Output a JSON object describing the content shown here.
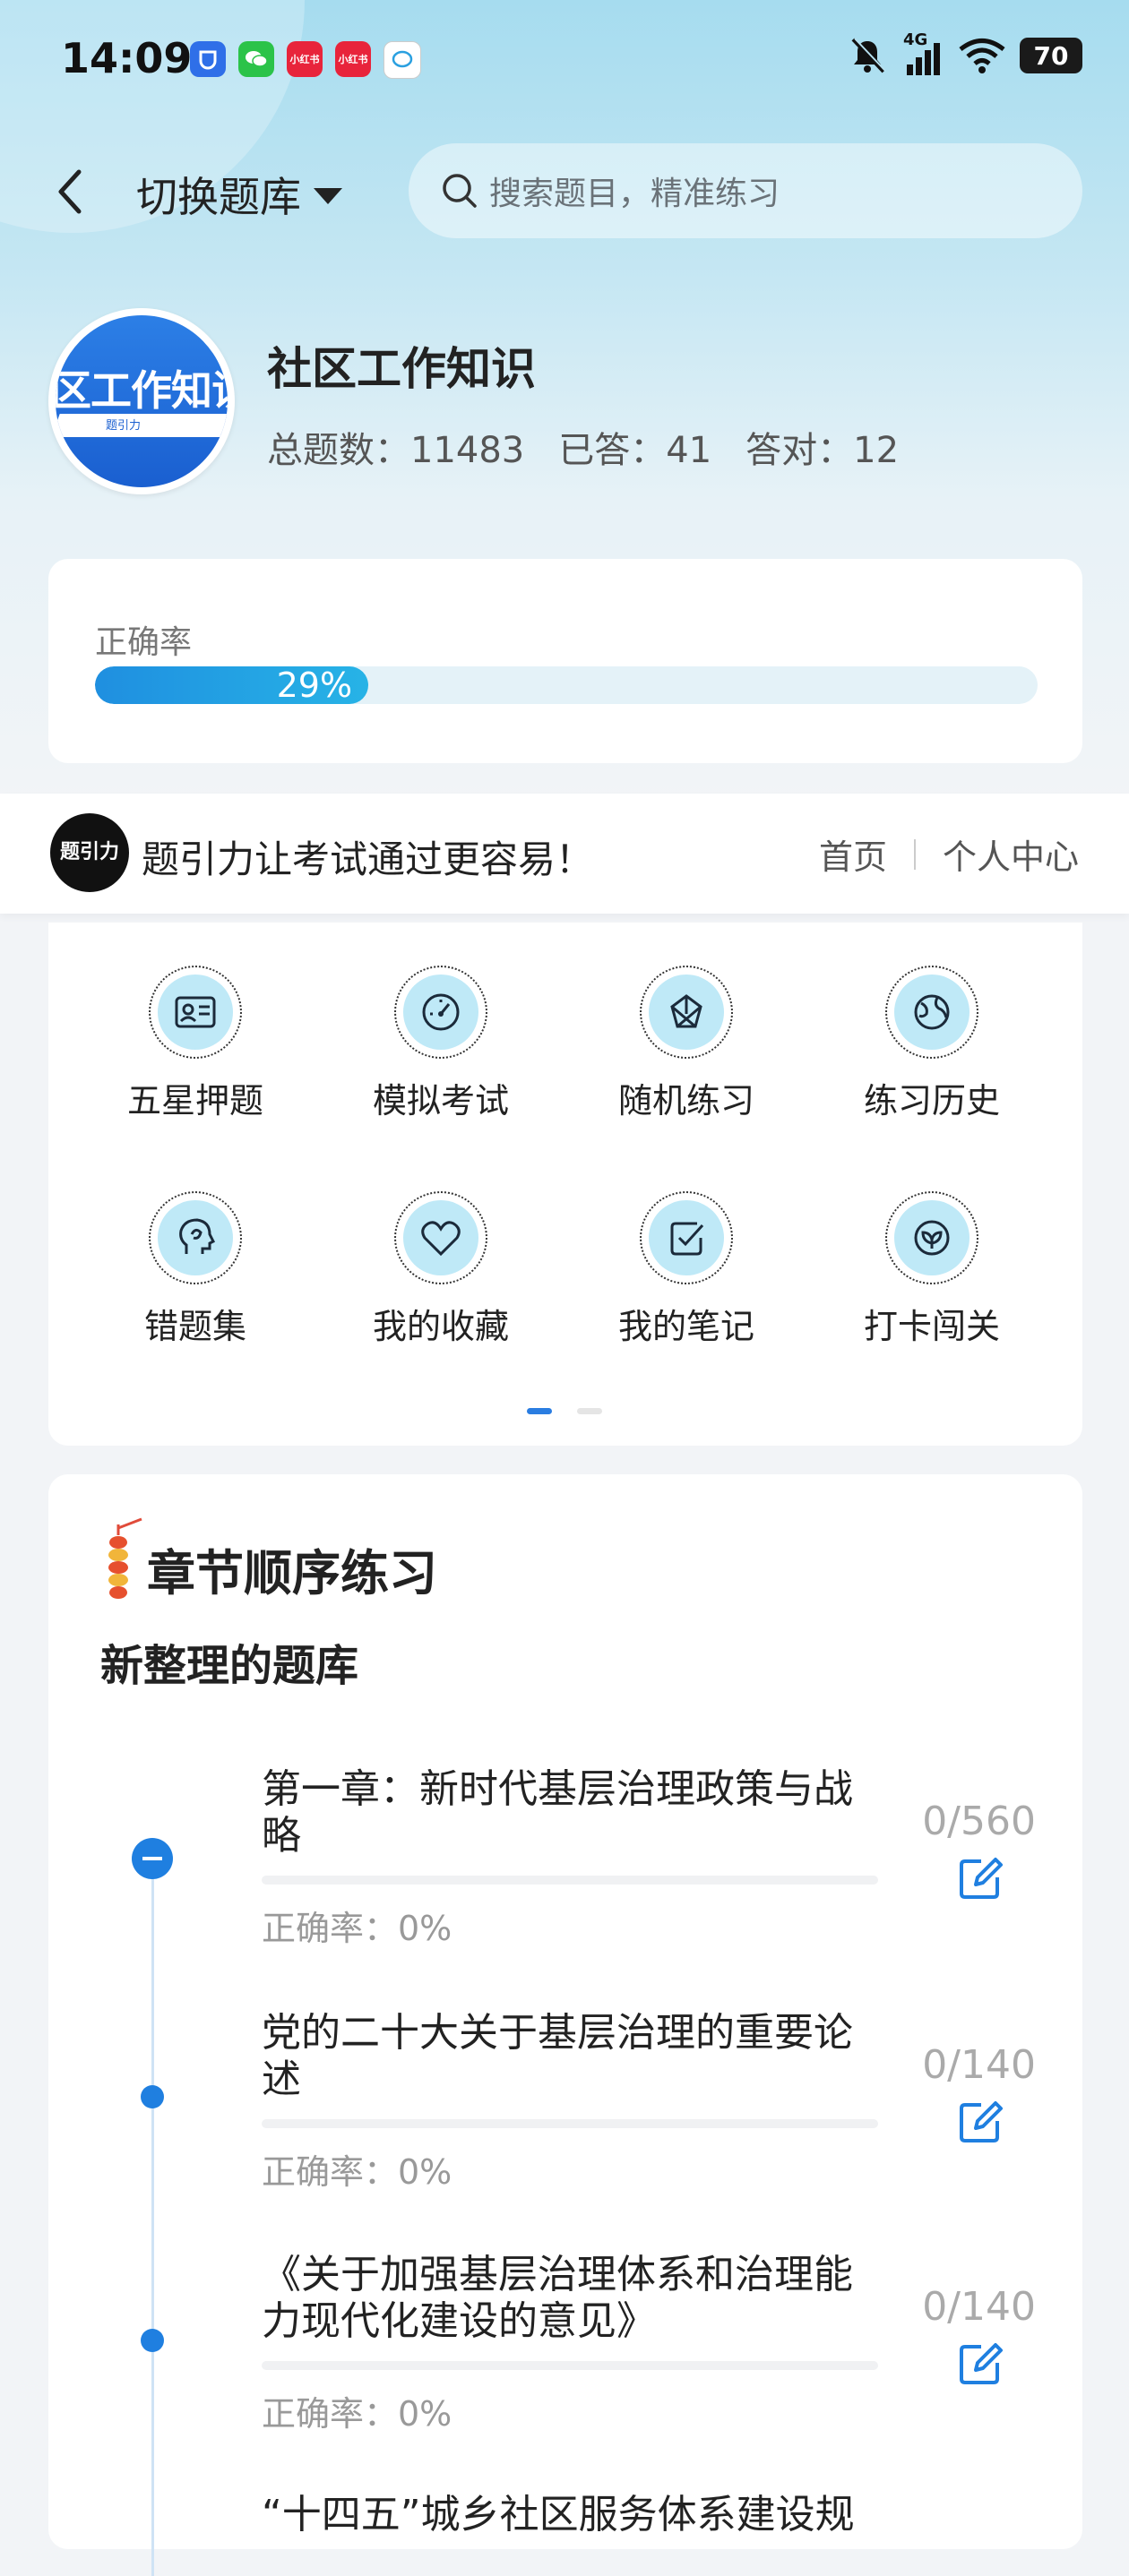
{
  "status_bar": {
    "time": "14:09",
    "network": "4G",
    "battery": "70",
    "notification_icons": [
      "app-shield-icon",
      "wechat-icon",
      "xiaohongshu-icon",
      "xiaohongshu-icon",
      "message-icon"
    ],
    "xhs_label": "小红书"
  },
  "header": {
    "switch_label": "切换题库",
    "search_placeholder": "搜索题目，精准练习"
  },
  "bank": {
    "logo_text": "区工作知识",
    "logo_sub": "题引力",
    "title": "社区工作知识",
    "total_label": "总题数：11483",
    "answered_label": "已答：41",
    "correct_label": "答对：12"
  },
  "accuracy": {
    "label": "正确率",
    "percent_text": "29%",
    "fraction": 0.29
  },
  "banner": {
    "logo_text": "题引力",
    "slogan": "题引力让考试通过更容易！",
    "nav_home": "首页",
    "nav_profile": "个人中心"
  },
  "functions": [
    {
      "label": "五星押题",
      "icon": "id-card-icon"
    },
    {
      "label": "模拟考试",
      "icon": "speedometer-icon"
    },
    {
      "label": "随机练习",
      "icon": "network-icon"
    },
    {
      "label": "练习历史",
      "icon": "globe-icon"
    },
    {
      "label": "错题集",
      "icon": "head-icon"
    },
    {
      "label": "我的收藏",
      "icon": "heart-icon"
    },
    {
      "label": "我的笔记",
      "icon": "check-note-icon"
    },
    {
      "label": "打卡闯关",
      "icon": "badge-icon"
    }
  ],
  "chapter_section": {
    "title": "章节顺序练习",
    "subtitle": "新整理的题库",
    "chapters": [
      {
        "name": "第一章：新时代基层治理政策与战略",
        "count": "0/560",
        "accuracy": "正确率：0%"
      },
      {
        "name": "党的二十大关于基层治理的重要论述",
        "count": "0/140",
        "accuracy": "正确率：0%"
      },
      {
        "name": "《关于加强基层治理体系和治理能力现代化建设的意见》",
        "count": "0/140",
        "accuracy": "正确率：0%"
      },
      {
        "name": "“十四五”城乡社区服务体系建设规",
        "count": "",
        "accuracy": ""
      }
    ]
  },
  "colors": {
    "accent": "#1f7fe0",
    "icon_fill": "#bfe9f7"
  }
}
